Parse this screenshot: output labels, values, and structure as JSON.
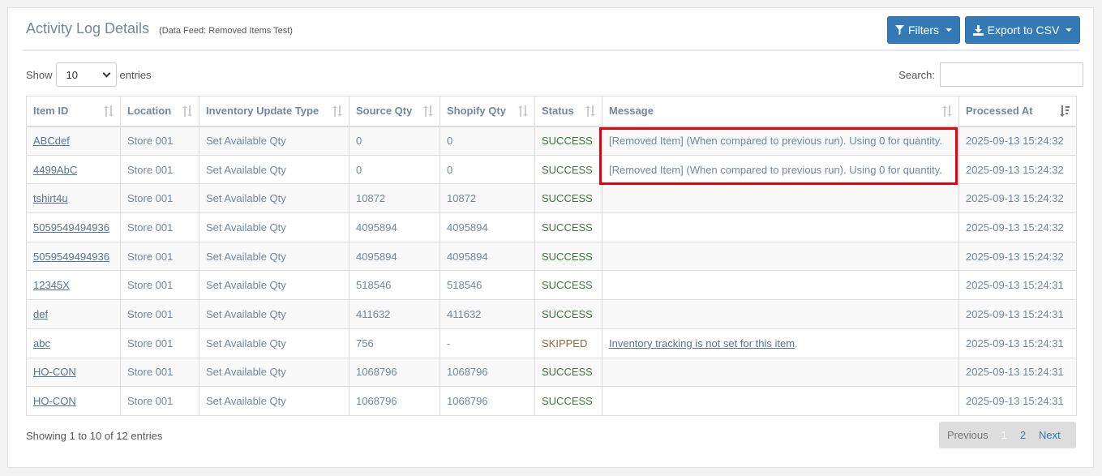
{
  "header": {
    "title": "Activity Log Details",
    "subtitle": "(Data Feed: Removed Items Test)",
    "filters_label": "Filters",
    "export_label": "Export to CSV"
  },
  "controls": {
    "show_label": "Show",
    "entries_value": "10",
    "entries_label": "entries",
    "search_label": "Search:",
    "search_value": ""
  },
  "table": {
    "columns": [
      "Item ID",
      "Location",
      "Inventory Update Type",
      "Source Qty",
      "Shopify Qty",
      "Status",
      "Message",
      "Processed At"
    ],
    "rows": [
      {
        "item_id": "ABCdef",
        "location": "Store 001",
        "type": "Set Available Qty",
        "source_qty": "0",
        "shopify_qty": "0",
        "status": "SUCCESS",
        "message": "[Removed Item] (When compared to previous run). Using 0 for quantity.",
        "message_link": "",
        "message_suffix": "",
        "processed_at": "2025-09-13 15:24:32"
      },
      {
        "item_id": "4499AbC",
        "location": "Store 001",
        "type": "Set Available Qty",
        "source_qty": "0",
        "shopify_qty": "0",
        "status": "SUCCESS",
        "message": "[Removed Item] (When compared to previous run). Using 0 for quantity.",
        "message_link": "",
        "message_suffix": "",
        "processed_at": "2025-09-13 15:24:32"
      },
      {
        "item_id": "tshirt4u",
        "location": "Store 001",
        "type": "Set Available Qty",
        "source_qty": "10872",
        "shopify_qty": "10872",
        "status": "SUCCESS",
        "message": "",
        "message_link": "",
        "message_suffix": "",
        "processed_at": "2025-09-13 15:24:32"
      },
      {
        "item_id": "5059549494936",
        "location": "Store 001",
        "type": "Set Available Qty",
        "source_qty": "4095894",
        "shopify_qty": "4095894",
        "status": "SUCCESS",
        "message": "",
        "message_link": "",
        "message_suffix": "",
        "processed_at": "2025-09-13 15:24:32"
      },
      {
        "item_id": "5059549494936",
        "location": "Store 001",
        "type": "Set Available Qty",
        "source_qty": "4095894",
        "shopify_qty": "4095894",
        "status": "SUCCESS",
        "message": "",
        "message_link": "",
        "message_suffix": "",
        "processed_at": "2025-09-13 15:24:32"
      },
      {
        "item_id": "12345X",
        "location": "Store 001",
        "type": "Set Available Qty",
        "source_qty": "518546",
        "shopify_qty": "518546",
        "status": "SUCCESS",
        "message": "",
        "message_link": "",
        "message_suffix": "",
        "processed_at": "2025-09-13 15:24:31"
      },
      {
        "item_id": "def",
        "location": "Store 001",
        "type": "Set Available Qty",
        "source_qty": "411632",
        "shopify_qty": "411632",
        "status": "SUCCESS",
        "message": "",
        "message_link": "",
        "message_suffix": "",
        "processed_at": "2025-09-13 15:24:31"
      },
      {
        "item_id": "abc",
        "location": "Store 001",
        "type": "Set Available Qty",
        "source_qty": "756",
        "shopify_qty": "-",
        "status": "SKIPPED",
        "message": "",
        "message_link": "Inventory tracking is not set for this item",
        "message_suffix": ".",
        "processed_at": "2025-09-13 15:24:31"
      },
      {
        "item_id": "HO-CON",
        "location": "Store 001",
        "type": "Set Available Qty",
        "source_qty": "1068796",
        "shopify_qty": "1068796",
        "status": "SUCCESS",
        "message": "",
        "message_link": "",
        "message_suffix": "",
        "processed_at": "2025-09-13 15:24:31"
      },
      {
        "item_id": "HO-CON",
        "location": "Store 001",
        "type": "Set Available Qty",
        "source_qty": "1068796",
        "shopify_qty": "1068796",
        "status": "SUCCESS",
        "message": "",
        "message_link": "",
        "message_suffix": "",
        "processed_at": "2025-09-13 15:24:31"
      }
    ]
  },
  "footer": {
    "info": "Showing 1 to 10 of 12 entries",
    "previous": "Previous",
    "page1": "1",
    "page2": "2",
    "next": "Next"
  },
  "colors": {
    "primary": "#337ab7",
    "success": "#3c763d",
    "skipped": "#8a6d3b",
    "highlight": "#e8000b"
  },
  "icons": {
    "filters": "filter-icon",
    "export": "download-icon",
    "sort": "sort-icon",
    "sorted_desc": "sort-desc-icon"
  }
}
